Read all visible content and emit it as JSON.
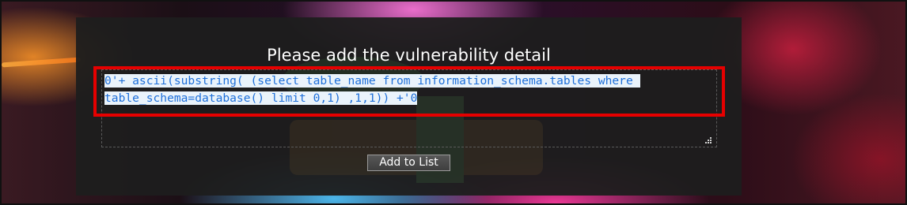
{
  "form": {
    "heading": "Please add the vulnerability detail",
    "detail_value": "0'+ ascii(substring( (select table_name from information_schema.tables where table_schema=database() limit 0,1) ,1,1)) +'0",
    "add_button_label": "Add to List"
  },
  "colors": {
    "panel_bg": "#1e1e1e",
    "highlight_border": "#e60000",
    "code_text": "#1e6fd9",
    "button_bg": "#4a4a4a"
  }
}
